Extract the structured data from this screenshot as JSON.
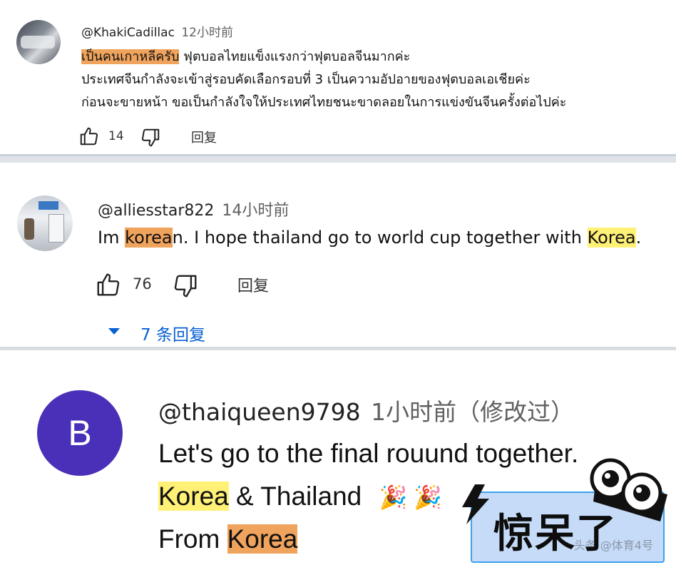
{
  "comments": [
    {
      "username": "@KhakiCadillac",
      "time": "12小时前",
      "text_highlight": "เป็นคนเกาหลีครับ",
      "text_line1_rest": " ฟุตบอลไทยแข็งแรงกว่าฟุตบอลจีนมากค่ะ",
      "text_line2": "ประเทศจีนกำลังจะเข้าสู่รอบคัดเลือกรอบที่ 3 เป็นความอัปอายของฟุตบอลเอเชียค่ะ",
      "text_line3": "ก่อนจะขายหน้า ขอเป็นกำลังใจให้ประเทศไทยชนะขาดลอยในการแข่งขันจีนครั้งต่อไปค่ะ",
      "likes": "14",
      "reply_label": "回复"
    },
    {
      "username": "@alliesstar822",
      "time": "14小时前",
      "text_a": "Im ",
      "text_hl1": "korea",
      "text_b": "n. I hope thailand go to world cup together with ",
      "text_hl2": "Korea",
      "text_c": ".",
      "likes": "76",
      "reply_label": "回复",
      "replies_label": "7 条回复"
    },
    {
      "username": "@thaiqueen9798",
      "time": "1小时前（修改过）",
      "avatar_letter": "B",
      "avatar_color": "#4a2fb8",
      "line1": "Let's go to the final  rouund together.",
      "line2_hl": "Korea",
      "line2_rest": " & Thailand",
      "line2_emoji": "🎉  🎉",
      "line3_a": "From ",
      "line3_hl": "Korea"
    }
  ],
  "sticker": {
    "text": "惊呆了",
    "watermark": "头条 @体育4号"
  },
  "icons": [
    "thumb-up-icon",
    "thumb-down-icon",
    "caret-down-icon",
    "lightning-icon",
    "eyes-icon",
    "party-popper-icon"
  ],
  "colors": {
    "highlight_orange": "#f0a35c",
    "highlight_yellow": "#fff176",
    "link_blue": "#065fd4",
    "avatar_purple": "#4a2fb8",
    "sticker_blue": "#3aa0f0"
  }
}
